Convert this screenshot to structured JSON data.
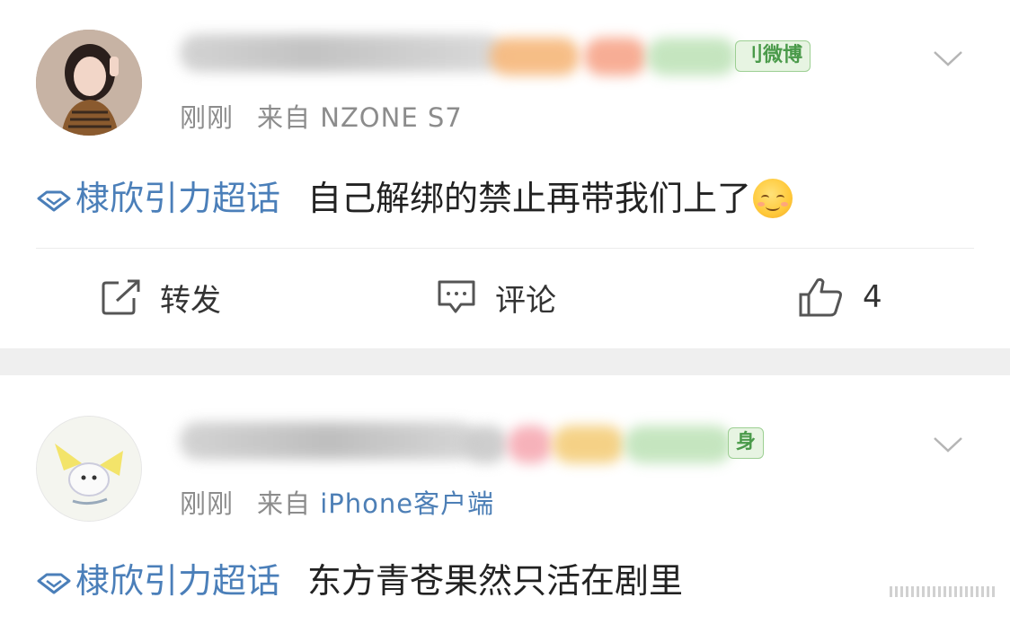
{
  "posts": [
    {
      "user_badge": "刂微博",
      "time": "刚刚",
      "source_prefix": "来自",
      "source": "NZONE S7",
      "topic": "棣欣引力超话",
      "text": "自己解绑的禁止再带我们上了",
      "emoji": "smiling-face-emoji",
      "actions": {
        "repost": "转发",
        "comment": "评论",
        "like_count": "4"
      }
    },
    {
      "user_badge": "身",
      "time": "刚刚",
      "source_prefix": "来自",
      "source": "iPhone客户端",
      "topic": "棣欣引力超话",
      "text": "东方青苍果然只活在剧里"
    }
  ],
  "colors": {
    "topic": "#4b7fb9",
    "source_link": "#4d7fb6",
    "meta_gray": "#8c8c8c",
    "badge_green": "#4a9a4a",
    "separator": "#efefef"
  }
}
